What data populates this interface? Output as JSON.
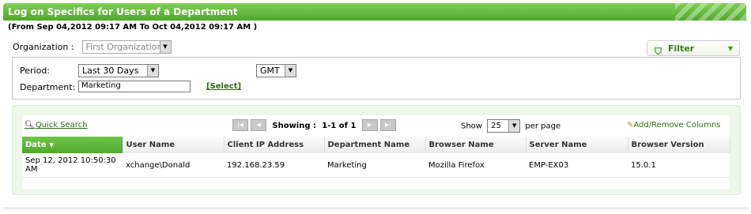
{
  "title": "Log on Specifics for Users of a Department",
  "date_range": "(From Sep 04,2012 09:17 AM To Oct 04,2012 09:17 AM )",
  "organization": {
    "label": "Organization :",
    "value": "First Organization"
  },
  "filter_button": {
    "label": "Filter"
  },
  "filters": {
    "period": {
      "label": "Period:",
      "value": "Last 30 Days"
    },
    "timezone": {
      "value": "GMT"
    },
    "department": {
      "label": "Department:",
      "value": "Marketing",
      "select_link": "[Select]"
    }
  },
  "toolbar": {
    "quick_search": "Quick Search",
    "showing": "Showing :",
    "range": "1-1 of 1",
    "show_label": "Show",
    "page_size": "25",
    "per_page": "per page",
    "add_remove_columns": "Add/Remove Columns"
  },
  "table": {
    "columns": [
      "Date",
      "User Name",
      "Client IP Address",
      "Department Name",
      "Browser Name",
      "Server Name",
      "Browser Version"
    ],
    "rows": [
      {
        "date": "Sep 12, 2012 10:50:30 AM",
        "user": "xchange\\Donald",
        "ip": "192.168.23.59",
        "dept": "Marketing",
        "browser": "Mozilla Firefox",
        "server": "EMP-EX03",
        "version": "15.0.1"
      }
    ]
  },
  "colors": {
    "accent": "#4fa82c",
    "link": "#2e6b12"
  },
  "icons": [
    "search-icon",
    "funnel-icon",
    "first-page-icon",
    "prev-page-icon",
    "next-page-icon",
    "last-page-icon",
    "columns-icon",
    "sort-desc-icon"
  ]
}
